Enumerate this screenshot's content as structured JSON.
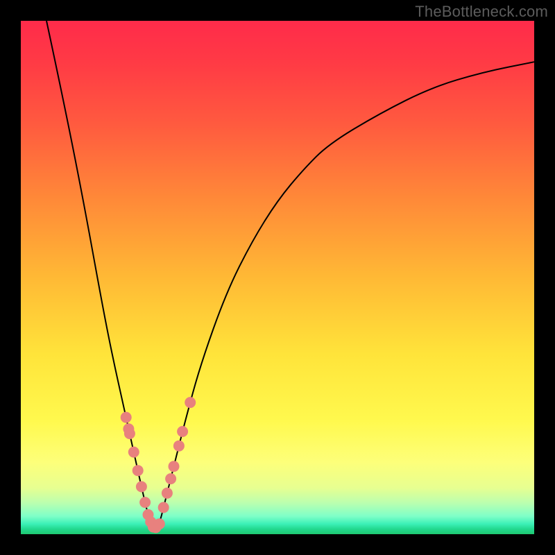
{
  "watermark": "TheBottleneck.com",
  "colors": {
    "dot": "#e8817e",
    "curve": "#000000",
    "frame": "#000000"
  },
  "chart_data": {
    "type": "line",
    "title": "",
    "xlabel": "",
    "ylabel": "",
    "xlim": [
      0,
      100
    ],
    "ylim": [
      0,
      100
    ],
    "grid": false,
    "legend": false,
    "series": [
      {
        "name": "bottleneck-curve",
        "x": [
          5,
          8,
          12,
          16,
          18,
          20,
          22,
          24,
          25,
          26,
          27,
          28,
          30,
          32,
          35,
          40,
          45,
          50,
          55,
          60,
          70,
          80,
          90,
          100
        ],
        "y": [
          100,
          86,
          66,
          44,
          34,
          25,
          16,
          7,
          3,
          1,
          2,
          6,
          14,
          22,
          33,
          47,
          57,
          65,
          71,
          76,
          82,
          87,
          90,
          92
        ]
      }
    ],
    "scatter_points": {
      "name": "sample-dots",
      "x": [
        20.5,
        21.0,
        21.2,
        22.0,
        22.8,
        23.5,
        24.2,
        24.8,
        25.3,
        25.8,
        26.3,
        27.0,
        27.8,
        28.5,
        29.2,
        29.8,
        30.8,
        31.5,
        33.0
      ],
      "y_from_curve": true
    }
  }
}
